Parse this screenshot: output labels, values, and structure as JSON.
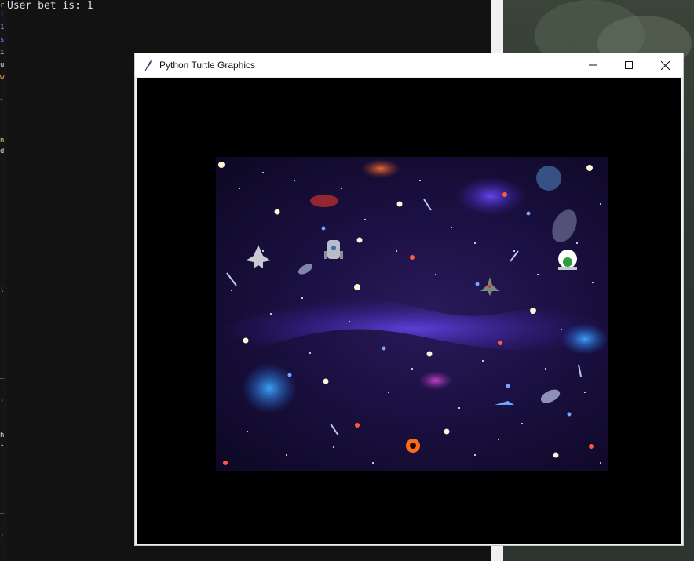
{
  "console": {
    "output_line": "User bet is: 1"
  },
  "window": {
    "title": "Python Turtle Graphics"
  },
  "icons": {
    "app": "turtle-feather-icon",
    "minimize": "minimize-icon",
    "maximize": "maximize-icon",
    "close": "close-icon"
  },
  "colors": {
    "canvas_bg": "#000000",
    "space_bg": "#1c1145",
    "nebula": "#4a2fc4",
    "titlebar": "#ffffff"
  }
}
